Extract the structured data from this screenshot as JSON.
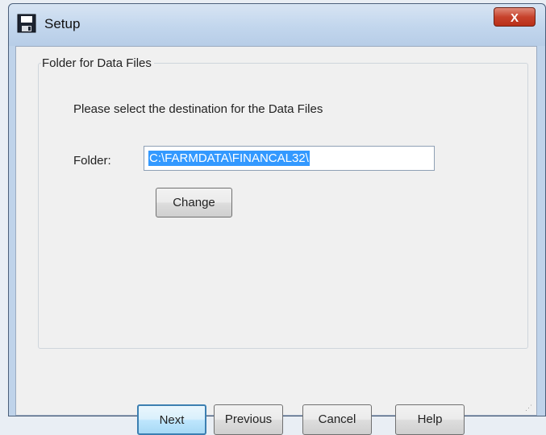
{
  "window": {
    "title": "Setup",
    "close_label": "X",
    "icon": "floppy-disk-icon"
  },
  "group": {
    "label": "Folder for Data Files",
    "instruction": "Please select the destination for the Data Files"
  },
  "folder": {
    "label": "Folder:",
    "value": "C:\\FARMDATA\\FINANCAL32\\",
    "change_label": "Change"
  },
  "buttons": {
    "next_label": "Next",
    "previous_label": "Previous",
    "cancel_label": "Cancel",
    "help_label": "Help"
  },
  "colors": {
    "selection": "#3399ff",
    "close_button": "#c7432c",
    "default_button_border": "#3c7fb1"
  }
}
